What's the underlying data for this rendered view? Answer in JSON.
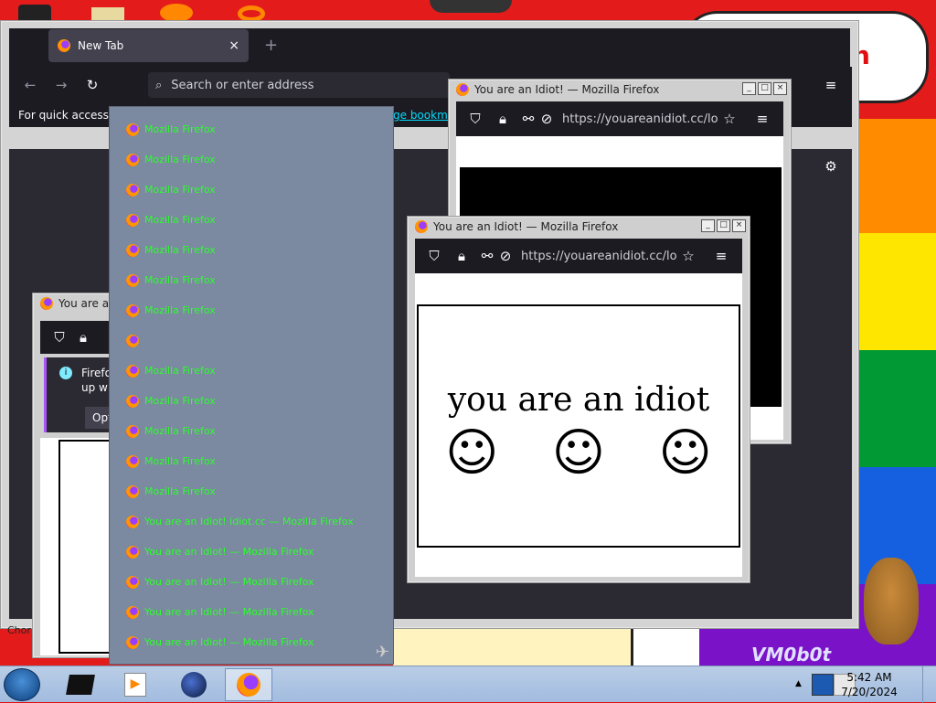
{
  "main_window": {
    "tab_title": "New Tab",
    "new_tab_symbol": "+",
    "url_placeholder": "Search or enter address",
    "bookmarks_hint_prefix": "For quick access, p",
    "bookmarks_hint_link": "ge bookma",
    "partial_bottom_text": "Chor"
  },
  "dropdown": {
    "items": [
      {
        "label": "Mozilla Firefox"
      },
      {
        "label": "Mozilla Firefox"
      },
      {
        "label": "Mozilla Firefox"
      },
      {
        "label": "Mozilla Firefox"
      },
      {
        "label": "Mozilla Firefox"
      },
      {
        "label": "Mozilla Firefox"
      },
      {
        "label": "Mozilla Firefox"
      },
      {
        "label": ""
      },
      {
        "label": "Mozilla Firefox"
      },
      {
        "label": "Mozilla Firefox"
      },
      {
        "label": "Mozilla Firefox"
      },
      {
        "label": "Mozilla Firefox"
      },
      {
        "label": "Mozilla Firefox"
      },
      {
        "label": "You are an Idiot! idiot.cc — Mozilla Firefox"
      },
      {
        "label": "You are an Idiot! — Mozilla Firefox"
      },
      {
        "label": "You are an Idiot! — Mozilla Firefox"
      },
      {
        "label": "You are an Idiot! — Mozilla Firefox"
      },
      {
        "label": "You are an Idiot! — Mozilla Firefox"
      }
    ]
  },
  "popup_back": {
    "title": "You are an Idiot! — Mozilla Firefox",
    "url": "https://youareanidiot.cc/lol."
  },
  "popup_front": {
    "title": "You are an Idiot! — Mozilla Firefox",
    "url": "https://youareanidiot.cc/lol.",
    "message": "you are an idiot",
    "smileys": [
      "☺",
      "☺",
      "☺"
    ]
  },
  "popup_left": {
    "title": "You are an",
    "notice_text_1": "Firefo",
    "notice_text_2": "up wi",
    "notice_button": "Opt"
  },
  "desktop": {
    "corner_text": "VM0b0t",
    "partial_red_text": "h"
  },
  "taskbar": {
    "time": "5:42 AM",
    "date": "7/20/2024"
  }
}
